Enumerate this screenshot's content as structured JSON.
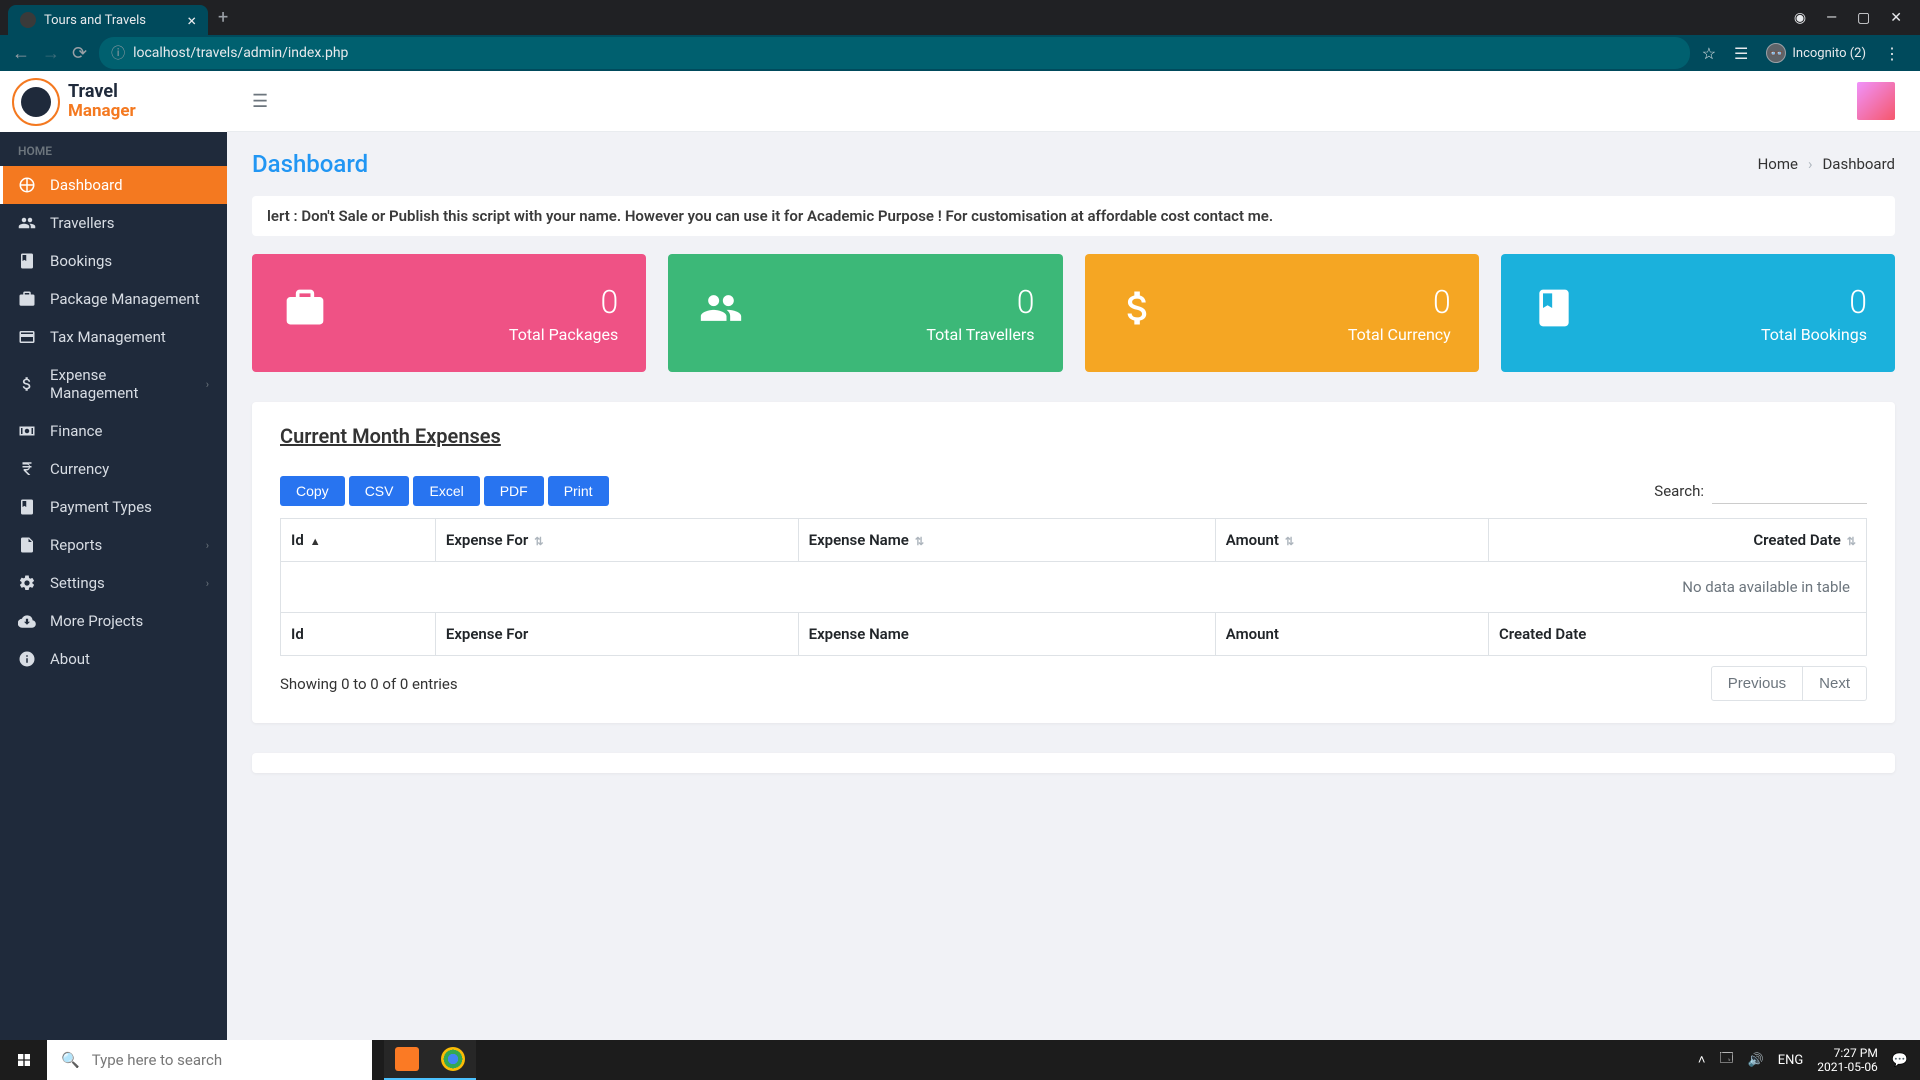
{
  "browser": {
    "tab_title": "Tours and Travels",
    "url": "localhost/travels/admin/index.php",
    "incognito_label": "Incognito (2)"
  },
  "brand": {
    "line1": "Travel",
    "line2": "Manager"
  },
  "sidebar": {
    "section": "HOME",
    "items": [
      {
        "label": "Dashboard"
      },
      {
        "label": "Travellers"
      },
      {
        "label": "Bookings"
      },
      {
        "label": "Package Management"
      },
      {
        "label": "Tax Management"
      },
      {
        "label": "Expense Management"
      },
      {
        "label": "Finance"
      },
      {
        "label": "Currency"
      },
      {
        "label": "Payment Types"
      },
      {
        "label": "Reports"
      },
      {
        "label": "Settings"
      },
      {
        "label": "More Projects"
      },
      {
        "label": "About"
      }
    ]
  },
  "page": {
    "title": "Dashboard",
    "crumb_home": "Home",
    "crumb_current": "Dashboard"
  },
  "alert": "lert : Don't Sale or Publish this script with your name. However you can use it for Academic Purpose ! For customisation at affordable cost contact me.",
  "stats": [
    {
      "value": "0",
      "label": "Total Packages"
    },
    {
      "value": "0",
      "label": "Total Travellers"
    },
    {
      "value": "0",
      "label": "Total Currency"
    },
    {
      "value": "0",
      "label": "Total Bookings"
    }
  ],
  "panel": {
    "title": "Current Month Expenses",
    "buttons": {
      "copy": "Copy",
      "csv": "CSV",
      "excel": "Excel",
      "pdf": "PDF",
      "print": "Print"
    },
    "search_label": "Search:",
    "columns": {
      "id": "Id",
      "for": "Expense For",
      "name": "Expense Name",
      "amount": "Amount",
      "date": "Created Date"
    },
    "no_data": "No data available in table",
    "info": "Showing 0 to 0 of 0 entries",
    "prev": "Previous",
    "next": "Next"
  },
  "taskbar": {
    "search_placeholder": "Type here to search",
    "lang": "ENG",
    "time": "7:27 PM",
    "date": "2021-05-06"
  }
}
